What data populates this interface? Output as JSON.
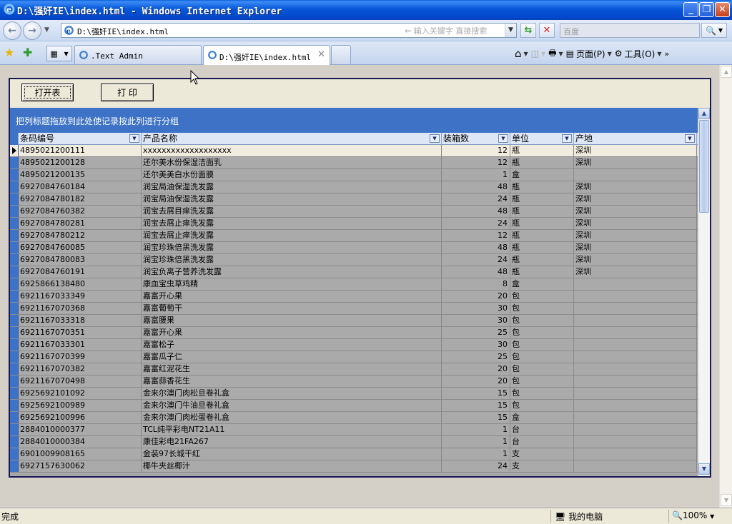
{
  "window": {
    "title": "D:\\强奸IE\\index.html - Windows Internet Explorer",
    "address": "D:\\强奸IE\\index.html",
    "address_hint": "输入关键字 直接搜索",
    "search_placeholder": "百度"
  },
  "tabs": [
    {
      "label": ".Text Admin",
      "active": false
    },
    {
      "label": "D:\\强奸IE\\index.html",
      "active": true
    }
  ],
  "toolbar": {
    "page_label": "页面(P)",
    "tools_label": "工具(O)"
  },
  "app": {
    "open_table_button": "打开表",
    "print_button": "打 印",
    "group_hint": "把列标题拖放到此处使记录按此列进行分组"
  },
  "grid": {
    "columns": [
      "条码编号",
      "产品名称",
      "装箱数",
      "单位",
      "产地"
    ],
    "rows": [
      [
        "4895021200111",
        "xxxxxxxxxxxxxxxxxxx",
        "12",
        "瓶",
        "深圳"
      ],
      [
        "4895021200128",
        "还尔美水份保湿洁面乳",
        "12",
        "瓶",
        "深圳"
      ],
      [
        "4895021200135",
        "还尔美美白水份面膜",
        "1",
        "盒",
        ""
      ],
      [
        "6927084760184",
        "润宝局油保湿洗发露",
        "48",
        "瓶",
        "深圳"
      ],
      [
        "6927084780182",
        "润宝局油保湿洗发露",
        "24",
        "瓶",
        "深圳"
      ],
      [
        "6927084760382",
        "润宝去屑目痒洗发露",
        "48",
        "瓶",
        "深圳"
      ],
      [
        "6927084780281",
        "润宝去屑止痒洗发露",
        "24",
        "瓶",
        "深圳"
      ],
      [
        "6927084780212",
        "润宝去屑止痒洗发露",
        "12",
        "瓶",
        "深圳"
      ],
      [
        "6927084760085",
        "润宝珍珠倍黑洗发露",
        "48",
        "瓶",
        "深圳"
      ],
      [
        "6927084780083",
        "润宝珍珠倍黑洗发露",
        "24",
        "瓶",
        "深圳"
      ],
      [
        "6927084760191",
        "润宝负离子营养洗发露",
        "48",
        "瓶",
        "深圳"
      ],
      [
        "6925866138480",
        "康血宝虫草鸡精",
        "8",
        "盒",
        ""
      ],
      [
        "6921167033349",
        "嘉富开心果",
        "20",
        "包",
        ""
      ],
      [
        "6921167070368",
        "嘉富葡萄干",
        "30",
        "包",
        ""
      ],
      [
        "6921167033318",
        "嘉富腰果",
        "30",
        "包",
        ""
      ],
      [
        "6921167070351",
        "嘉富开心果",
        "25",
        "包",
        ""
      ],
      [
        "6921167033301",
        "嘉富松子",
        "30",
        "包",
        ""
      ],
      [
        "6921167070399",
        "嘉富瓜子仁",
        "25",
        "包",
        ""
      ],
      [
        "6921167070382",
        "嘉富红泥花生",
        "20",
        "包",
        ""
      ],
      [
        "6921167070498",
        "嘉富蒜香花生",
        "20",
        "包",
        ""
      ],
      [
        "6925692101092",
        "金来尔澳门肉松旦卷礼盒",
        "15",
        "包",
        ""
      ],
      [
        "6925692100989",
        "金来尔澳门牛油旦卷礼盒",
        "15",
        "包",
        ""
      ],
      [
        "6925692100996",
        "金来尔澳门肉松蛋卷礼盒",
        "15",
        "盒",
        ""
      ],
      [
        "2884010000377",
        "TCL纯平彩电NT21A11",
        "1",
        "台",
        ""
      ],
      [
        "2884010000384",
        "康佳彩电21FA267",
        "1",
        "台",
        ""
      ],
      [
        "6901009908165",
        "金装97长城干红",
        "1",
        "支",
        ""
      ],
      [
        "6927157630062",
        "椰牛夹丝椰汁",
        "24",
        "支",
        ""
      ]
    ]
  },
  "status": {
    "left": "完成",
    "zone": "我的电脑",
    "zoom": "100%"
  }
}
